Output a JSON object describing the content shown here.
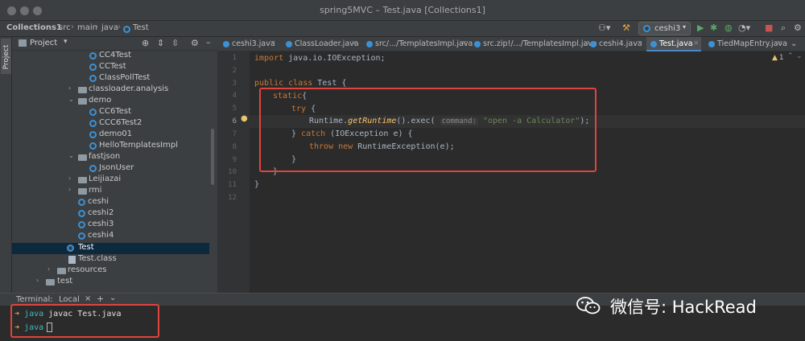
{
  "window": {
    "title": "spring5MVC – Test.java [Collections1]"
  },
  "breadcrumb": [
    "Collections1",
    "src",
    "main",
    "java",
    "Test"
  ],
  "toolbar": {
    "run_config": "ceshi3"
  },
  "project_panel": {
    "title": "Project",
    "tree": [
      {
        "label": "CC4Test",
        "kind": "class"
      },
      {
        "label": "CCTest",
        "kind": "class"
      },
      {
        "label": "ClassPollTest",
        "kind": "class"
      },
      {
        "label": "classloader.analysis",
        "kind": "folder",
        "arrow": "›"
      },
      {
        "label": "demo",
        "kind": "folder",
        "arrow": "⌄"
      },
      {
        "label": "CC6Test",
        "kind": "class"
      },
      {
        "label": "CCC6Test2",
        "kind": "class"
      },
      {
        "label": "demo01",
        "kind": "class"
      },
      {
        "label": "HelloTemplatesImpl",
        "kind": "class"
      },
      {
        "label": "fastjson",
        "kind": "folder",
        "arrow": "⌄"
      },
      {
        "label": "JsonUser",
        "kind": "class"
      },
      {
        "label": "Leijiazai",
        "kind": "folder",
        "arrow": "›"
      },
      {
        "label": "rmi",
        "kind": "folder",
        "arrow": "›"
      },
      {
        "label": "ceshi",
        "kind": "class"
      },
      {
        "label": "ceshi2",
        "kind": "class"
      },
      {
        "label": "ceshi3",
        "kind": "class"
      },
      {
        "label": "ceshi4",
        "kind": "class"
      },
      {
        "label": "Test",
        "kind": "class",
        "selected": true
      },
      {
        "label": "Test.class",
        "kind": "classfile"
      },
      {
        "label": "resources",
        "kind": "folder",
        "arrow": "›"
      },
      {
        "label": "test",
        "kind": "folder",
        "arrow": "›"
      }
    ]
  },
  "tabs": [
    {
      "label": "ceshi3.java"
    },
    {
      "label": "ClassLoader.java"
    },
    {
      "label": "src/.../TemplatesImpl.java"
    },
    {
      "label": "src.zip!/.../TemplatesImpl.java"
    },
    {
      "label": "ceshi4.java"
    },
    {
      "label": "Test.java",
      "active": true
    },
    {
      "label": "TiedMapEntry.java"
    }
  ],
  "editor": {
    "line_numbers": [
      "1",
      "2",
      "3",
      "4",
      "5",
      "6",
      "7",
      "8",
      "9",
      "10",
      "11",
      "12"
    ],
    "warning_count": "1",
    "code": {
      "l1_kw": "import",
      "l1_rest": " java.io.IOException;",
      "l3_kw": "public class",
      "l3_rest": " Test {",
      "l4_kw": "static",
      "l4_rest": "{",
      "l5_kw": "try",
      "l5_rest": " {",
      "l6_a": "Runtime.",
      "l6_method": "getRuntime",
      "l6_b": "().exec( ",
      "l6_hint": "command:",
      "l6_str": "\"open -a Calculator\"",
      "l6_c": ");",
      "l7_a": "} ",
      "l7_kw": "catch",
      "l7_rest": " (IOException e) {",
      "l8_kw": "throw new",
      "l8_rest": " RuntimeException(e);",
      "l9": "}",
      "l10": "}",
      "l11": "}"
    }
  },
  "terminal": {
    "label": "Terminal:",
    "tab": "Local",
    "lines": [
      {
        "prompt": "java",
        "cmd": " javac Test.java"
      },
      {
        "prompt": "java",
        "cmd": ""
      }
    ]
  },
  "watermark": {
    "text": "微信号: HackRead"
  }
}
